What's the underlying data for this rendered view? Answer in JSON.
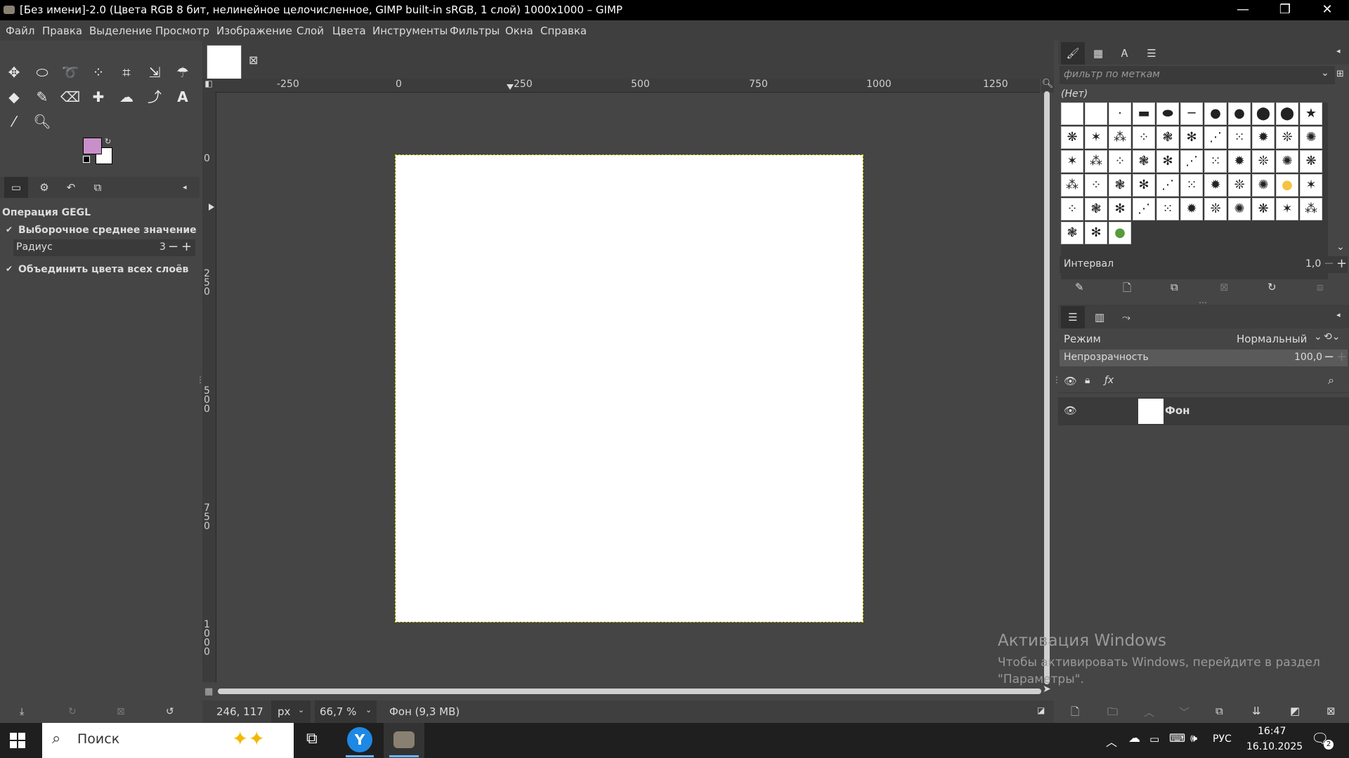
{
  "titlebar": {
    "title": "[Без имени]-2.0 (Цвета RGB 8 бит, нелинейное целочисленное, GIMP built-in sRGB, 1 слой) 1000x1000 – GIMP"
  },
  "menubar": [
    "Файл",
    "Правка",
    "Выделение",
    "Просмотр",
    "Изображение",
    "Слой",
    "Цвета",
    "Инструменты",
    "Фильтры",
    "Окна",
    "Справка"
  ],
  "tool_options": {
    "title": "Операция GEGL",
    "checkbox1": "Выборочное среднее значение",
    "radius_label": "Радиус",
    "radius_value": "3",
    "checkbox2": "Объединить цвета всех слоёв"
  },
  "colors": {
    "foreground": "#c98fc9",
    "background": "#ffffff"
  },
  "ruler_top_labels": [
    "-250",
    "0",
    "250",
    "500",
    "750",
    "1000",
    "1250"
  ],
  "ruler_left_labels": [
    "0",
    "2\n5\n0",
    "5\n0\n0",
    "7\n5\n0",
    "1\n0\n0\n0"
  ],
  "statusbar": {
    "coords": "246, 117",
    "unit": "px",
    "zoom": "66,7 %",
    "layer_info": "Фон (9,3 МВ)"
  },
  "brushes": {
    "filter_placeholder": "фильтр по меткам",
    "current": "(Нет)",
    "spacing_label": "Интервал",
    "spacing_value": "1,0"
  },
  "layers": {
    "mode_label": "Режим",
    "mode_value": "Нормальный",
    "opacity_label": "Непрозрачность",
    "opacity_value": "100,0",
    "layer_name": "Фон"
  },
  "watermark": {
    "title": "Активация Windows",
    "line1": "Чтобы активировать Windows, перейдите в раздел",
    "line2": "\"Параметры\"."
  },
  "taskbar": {
    "search_label": "Поиск",
    "lang": "РУС",
    "time": "16:47",
    "date": "16.10.2025",
    "notif_count": "2"
  }
}
